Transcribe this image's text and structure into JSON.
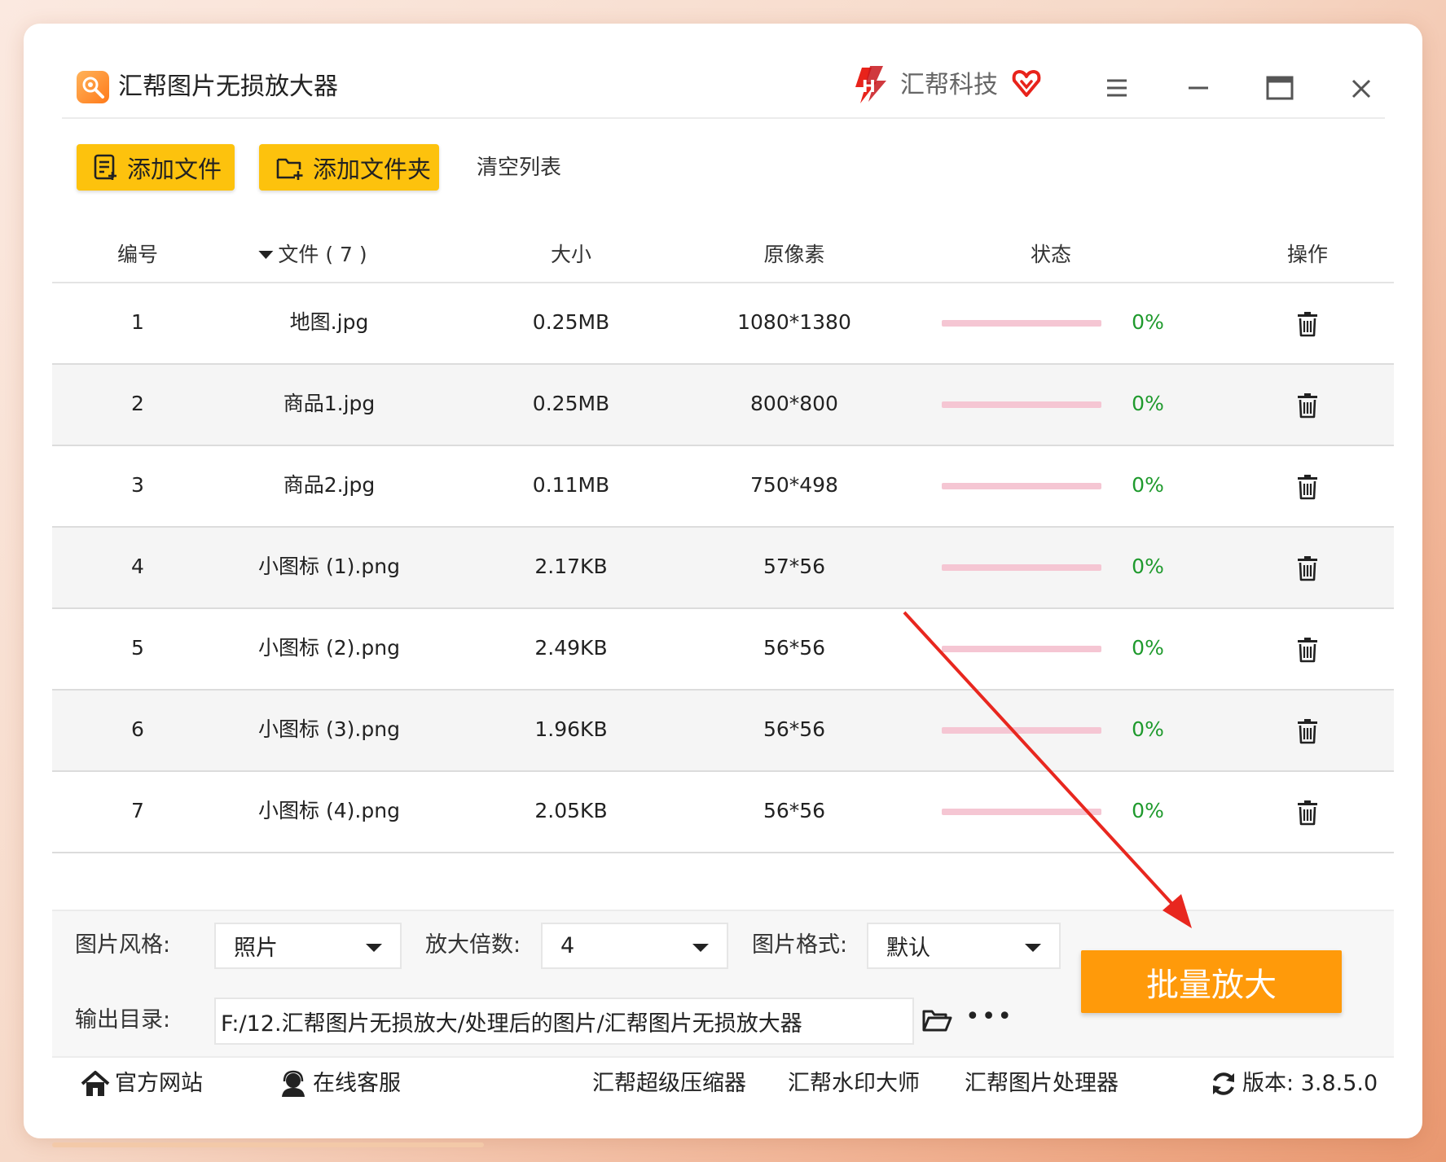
{
  "window": {
    "title": "汇帮图片无损放大器",
    "brand": "汇帮科技"
  },
  "toolbar": {
    "add_file_label": "添加文件",
    "add_folder_label": "添加文件夹",
    "clear_label": "清空列表"
  },
  "table": {
    "headers": {
      "index": "编号",
      "file": "文件 ( 7 )",
      "size": "大小",
      "pixels": "原像素",
      "status": "状态",
      "action": "操作"
    },
    "rows": [
      {
        "index": "1",
        "name": "地图.jpg",
        "size": "0.25MB",
        "pixels": "1080*1380",
        "progress": "0%",
        "progress_value": 0
      },
      {
        "index": "2",
        "name": "商品1.jpg",
        "size": "0.25MB",
        "pixels": "800*800",
        "progress": "0%",
        "progress_value": 0
      },
      {
        "index": "3",
        "name": "商品2.jpg",
        "size": "0.11MB",
        "pixels": "750*498",
        "progress": "0%",
        "progress_value": 0
      },
      {
        "index": "4",
        "name": "小图标 (1).png",
        "size": "2.17KB",
        "pixels": "57*56",
        "progress": "0%",
        "progress_value": 0
      },
      {
        "index": "5",
        "name": "小图标 (2).png",
        "size": "2.49KB",
        "pixels": "56*56",
        "progress": "0%",
        "progress_value": 0
      },
      {
        "index": "6",
        "name": "小图标 (3).png",
        "size": "1.96KB",
        "pixels": "56*56",
        "progress": "0%",
        "progress_value": 0
      },
      {
        "index": "7",
        "name": "小图标 (4).png",
        "size": "2.05KB",
        "pixels": "56*56",
        "progress": "0%",
        "progress_value": 0
      }
    ]
  },
  "settings": {
    "style_label": "图片风格:",
    "style_value": "照片",
    "scale_label": "放大倍数:",
    "scale_value": "4",
    "format_label": "图片格式:",
    "format_value": "默认",
    "output_label": "输出目录:",
    "output_path": "F:/12.汇帮图片无损放大/处理后的图片/汇帮图片无损放大器",
    "more_label": "•••",
    "batch_label": "批量放大"
  },
  "footer": {
    "website": "官方网站",
    "support": "在线客服",
    "compressor": "汇帮超级压缩器",
    "watermark": "汇帮水印大师",
    "processor": "汇帮图片处理器",
    "version": "版本: 3.8.5.0"
  },
  "colors": {
    "accent_yellow": "#fdc20d",
    "batch_orange": "#ff9a0a",
    "progress_track": "#f5c6d3",
    "percent_green": "#1f9a2d",
    "annotation_arrow": "#e8271f"
  }
}
